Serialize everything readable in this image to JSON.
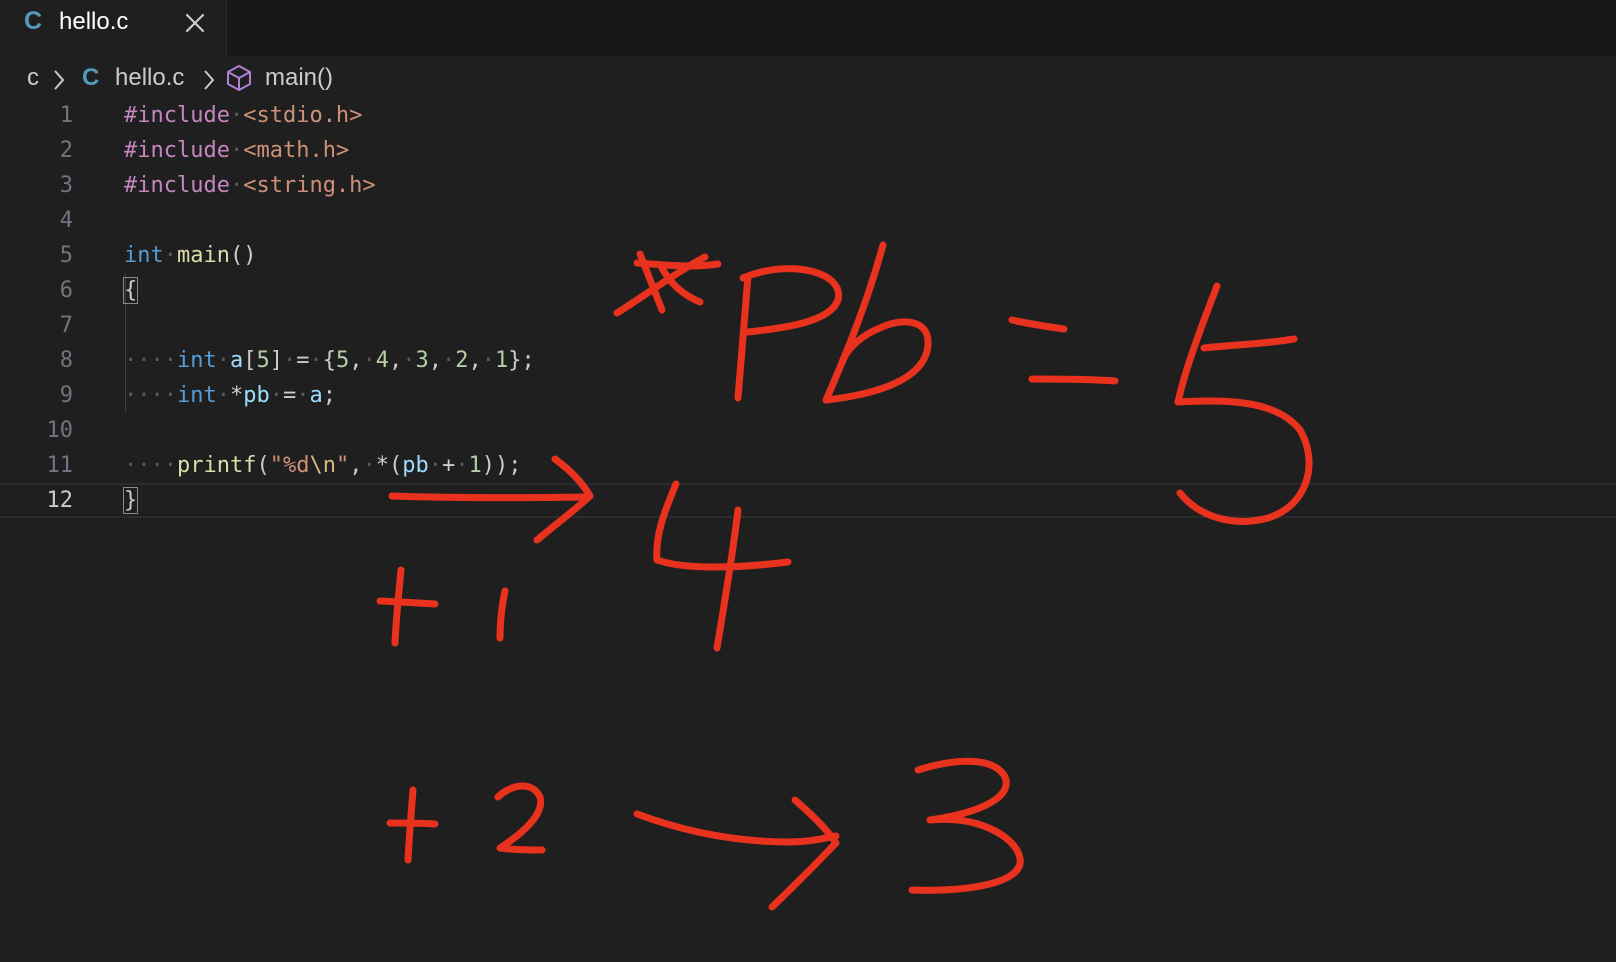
{
  "tab": {
    "icon": "c-language-icon",
    "icon_glyph": "C",
    "label": "hello.c"
  },
  "breadcrumb": {
    "folder": "c",
    "file_icon_glyph": "C",
    "file": "hello.c",
    "symbol": "main()"
  },
  "editor": {
    "lines": [
      {
        "n": "1",
        "tokens": [
          [
            "#include",
            "dir"
          ],
          [
            "·",
            "ws"
          ],
          [
            "<stdio.h>",
            "str"
          ]
        ]
      },
      {
        "n": "2",
        "tokens": [
          [
            "#include",
            "dir"
          ],
          [
            "·",
            "ws"
          ],
          [
            "<math.h>",
            "str"
          ]
        ]
      },
      {
        "n": "3",
        "tokens": [
          [
            "#include",
            "dir"
          ],
          [
            "·",
            "ws"
          ],
          [
            "<string.h>",
            "str"
          ]
        ]
      },
      {
        "n": "4",
        "tokens": []
      },
      {
        "n": "5",
        "tokens": [
          [
            "int",
            "kw"
          ],
          [
            "·",
            "ws"
          ],
          [
            "main",
            "fn"
          ],
          [
            "()",
            "p"
          ]
        ]
      },
      {
        "n": "6",
        "tokens": [
          [
            "{",
            "brace"
          ]
        ]
      },
      {
        "n": "7",
        "tokens": []
      },
      {
        "n": "8",
        "tokens": [
          [
            "····",
            "ws"
          ],
          [
            "int",
            "kw"
          ],
          [
            "·",
            "ws"
          ],
          [
            "a",
            "var"
          ],
          [
            "[",
            "p"
          ],
          [
            "5",
            "num"
          ],
          [
            "]",
            "p"
          ],
          [
            "·",
            "ws"
          ],
          [
            "=",
            "p"
          ],
          [
            "·",
            "ws"
          ],
          [
            "{",
            "p"
          ],
          [
            "5",
            "num"
          ],
          [
            ",",
            "p"
          ],
          [
            "·",
            "ws"
          ],
          [
            "4",
            "num"
          ],
          [
            ",",
            "p"
          ],
          [
            "·",
            "ws"
          ],
          [
            "3",
            "num"
          ],
          [
            ",",
            "p"
          ],
          [
            "·",
            "ws"
          ],
          [
            "2",
            "num"
          ],
          [
            ",",
            "p"
          ],
          [
            "·",
            "ws"
          ],
          [
            "1",
            "num"
          ],
          [
            "};",
            "p"
          ]
        ]
      },
      {
        "n": "9",
        "tokens": [
          [
            "····",
            "ws"
          ],
          [
            "int",
            "kw"
          ],
          [
            "·",
            "ws"
          ],
          [
            "*",
            "p"
          ],
          [
            "pb",
            "var"
          ],
          [
            "·",
            "ws"
          ],
          [
            "=",
            "p"
          ],
          [
            "·",
            "ws"
          ],
          [
            "a",
            "var"
          ],
          [
            ";",
            "p"
          ]
        ]
      },
      {
        "n": "10",
        "tokens": []
      },
      {
        "n": "11",
        "tokens": [
          [
            "····",
            "ws"
          ],
          [
            "printf",
            "fn"
          ],
          [
            "(",
            "p"
          ],
          [
            "\"%d",
            "str"
          ],
          [
            "\\n",
            "esc"
          ],
          [
            "\"",
            "str"
          ],
          [
            ",",
            "p"
          ],
          [
            "·",
            "ws"
          ],
          [
            "*",
            "p"
          ],
          [
            "(",
            "p"
          ],
          [
            "pb",
            "var"
          ],
          [
            "·",
            "ws"
          ],
          [
            "+",
            "p"
          ],
          [
            "·",
            "ws"
          ],
          [
            "1",
            "num"
          ],
          [
            "));",
            "p"
          ]
        ]
      },
      {
        "n": "12",
        "tokens": [
          [
            "}",
            "brace"
          ]
        ],
        "current": true
      }
    ]
  },
  "annotation": {
    "color": "#e8321e"
  }
}
